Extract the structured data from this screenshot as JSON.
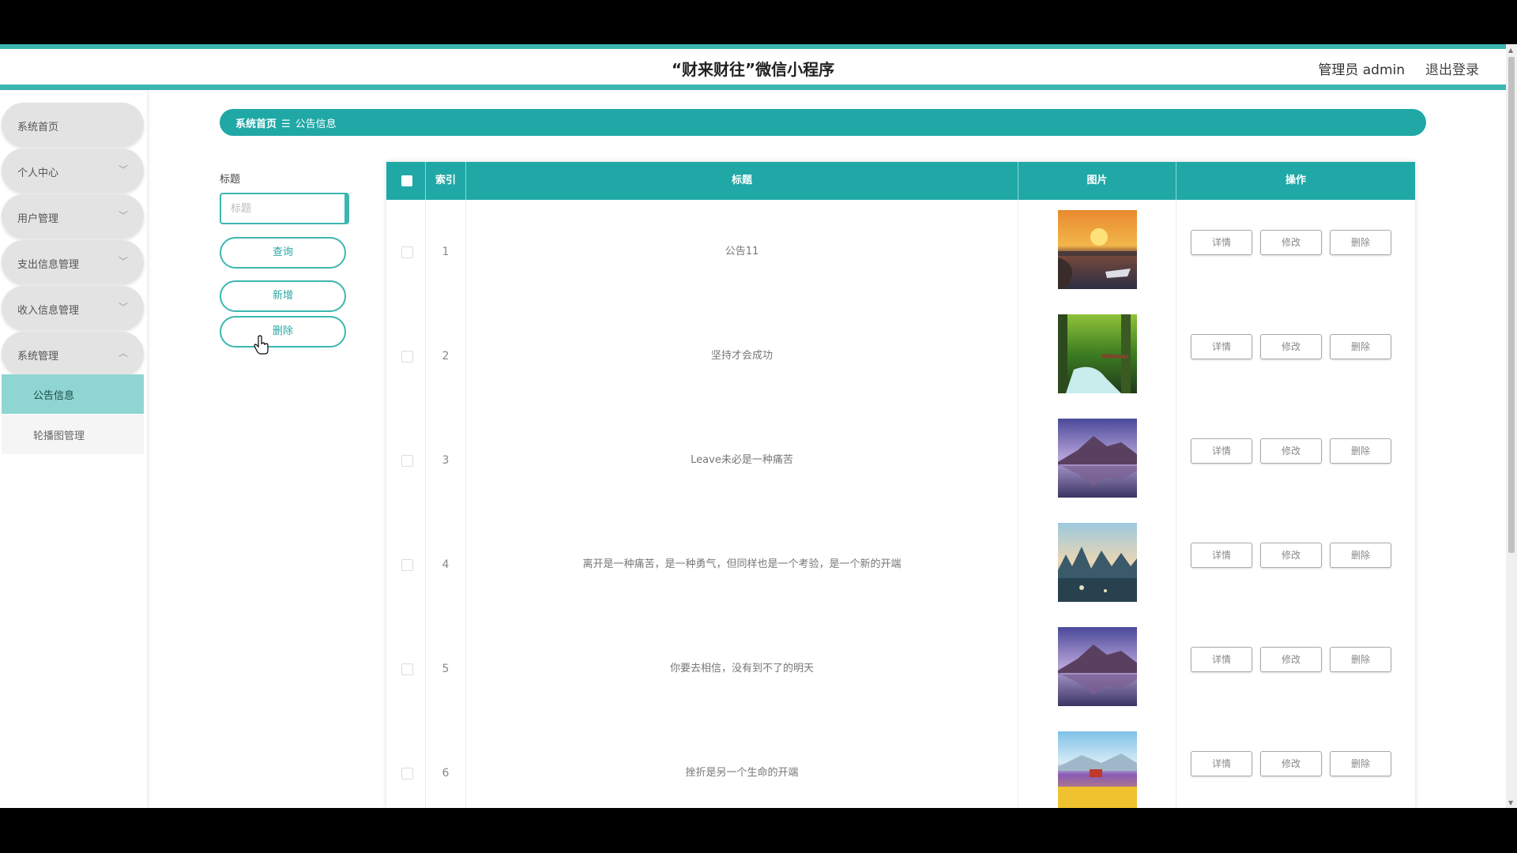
{
  "header": {
    "title": "“财来财往”微信小程序",
    "user": "管理员 admin",
    "logout": "退出登录"
  },
  "sidebar": {
    "items": [
      {
        "label": "系统首页"
      },
      {
        "label": "个人中心",
        "icon": "chevron-down-icon"
      },
      {
        "label": "用户管理",
        "icon": "chevron-down-icon"
      },
      {
        "label": "支出信息管理",
        "icon": "chevron-down-icon"
      },
      {
        "label": "收入信息管理",
        "icon": "chevron-down-icon"
      },
      {
        "label": "系统管理",
        "icon": "chevron-up-icon"
      }
    ],
    "subitems": [
      {
        "label": "公告信息",
        "active": true
      },
      {
        "label": "轮播图管理",
        "active": false
      }
    ]
  },
  "breadcrumb": {
    "home": "系统首页",
    "separator": "☰",
    "current": "公告信息"
  },
  "filter": {
    "label": "标题",
    "placeholder": "标题",
    "query_label": "查询",
    "add_label": "新增",
    "delete_label": "删除"
  },
  "table": {
    "headers": {
      "index": "索引",
      "title": "标题",
      "image": "图片",
      "actions": "操作"
    },
    "rows": [
      {
        "index": "1",
        "title": "公告11",
        "image": "sunset-boats-photo"
      },
      {
        "index": "2",
        "title": "坚持才会成功",
        "image": "forest-waterfall-photo"
      },
      {
        "index": "3",
        "title": "Leave未必是一种痛苦",
        "image": "purple-mountain-lake-photo"
      },
      {
        "index": "4",
        "title": "离开是一种痛苦，是一种勇气，但同样也是一个考验，是一个新的开端",
        "image": "karst-mountains-photo"
      },
      {
        "index": "5",
        "title": "你要去相信，没有到不了的明天",
        "image": "purple-mountain-lake-photo"
      },
      {
        "index": "6",
        "title": "挫折是另一个生命的开端",
        "image": "flower-field-painting"
      }
    ],
    "actions": {
      "detail": "详情",
      "edit": "修改",
      "delete": "删除"
    }
  },
  "colors": {
    "accent": "#1fa8a6",
    "active_menu": "#8fd6d2"
  }
}
